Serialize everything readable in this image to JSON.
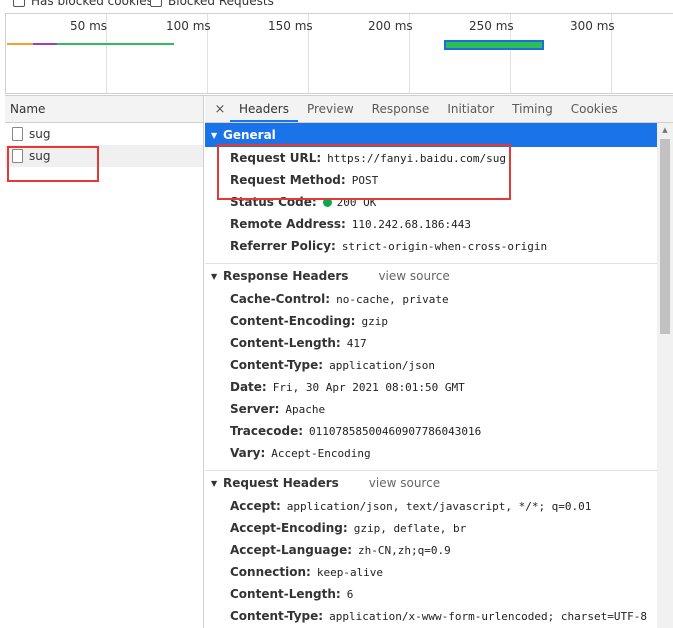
{
  "filters": [
    {
      "label": "Has blocked cookies"
    },
    {
      "label": "Blocked Requests"
    }
  ],
  "overview": {
    "ticks": [
      "50 ms",
      "100 ms",
      "150 ms",
      "200 ms",
      "250 ms",
      "300 ms"
    ]
  },
  "name_panel": {
    "header": "Name",
    "items": [
      {
        "label": "sug"
      },
      {
        "label": "sug"
      }
    ]
  },
  "tabs": {
    "close": "×",
    "items": [
      {
        "label": "Headers"
      },
      {
        "label": "Preview"
      },
      {
        "label": "Response"
      },
      {
        "label": "Initiator"
      },
      {
        "label": "Timing"
      },
      {
        "label": "Cookies"
      }
    ]
  },
  "general": {
    "title": "General",
    "request_url_key": "Request URL:",
    "request_url": "https://fanyi.baidu.com/sug",
    "request_method_key": "Request Method:",
    "request_method": "POST",
    "status_code_key": "Status Code:",
    "status_code": "200 OK",
    "remote_address_key": "Remote Address:",
    "remote_address": "110.242.68.186:443",
    "referrer_policy_key": "Referrer Policy:",
    "referrer_policy": "strict-origin-when-cross-origin"
  },
  "response_headers": {
    "title": "Response Headers",
    "view_source": "view source",
    "rows": [
      {
        "k": "Cache-Control:",
        "v": "no-cache, private"
      },
      {
        "k": "Content-Encoding:",
        "v": "gzip"
      },
      {
        "k": "Content-Length:",
        "v": "417"
      },
      {
        "k": "Content-Type:",
        "v": "application/json"
      },
      {
        "k": "Date:",
        "v": "Fri, 30 Apr 2021 08:01:50 GMT"
      },
      {
        "k": "Server:",
        "v": "Apache"
      },
      {
        "k": "Tracecode:",
        "v": "01107858500460907786043016"
      },
      {
        "k": "Vary:",
        "v": "Accept-Encoding"
      }
    ]
  },
  "request_headers": {
    "title": "Request Headers",
    "view_source": "view source",
    "rows": [
      {
        "k": "Accept:",
        "v": "application/json, text/javascript, */*; q=0.01"
      },
      {
        "k": "Accept-Encoding:",
        "v": "gzip, deflate, br"
      },
      {
        "k": "Accept-Language:",
        "v": "zh-CN,zh;q=0.9"
      },
      {
        "k": "Connection:",
        "v": "keep-alive"
      },
      {
        "k": "Content-Length:",
        "v": "6"
      },
      {
        "k": "Content-Type:",
        "v": "application/x-www-form-urlencoded; charset=UTF-8"
      }
    ]
  },
  "colors": {
    "accent": "#1a73e8",
    "highlight": "#e53935",
    "status_ok": "#0aa84f",
    "timing_bar": "#2fbd5c"
  }
}
